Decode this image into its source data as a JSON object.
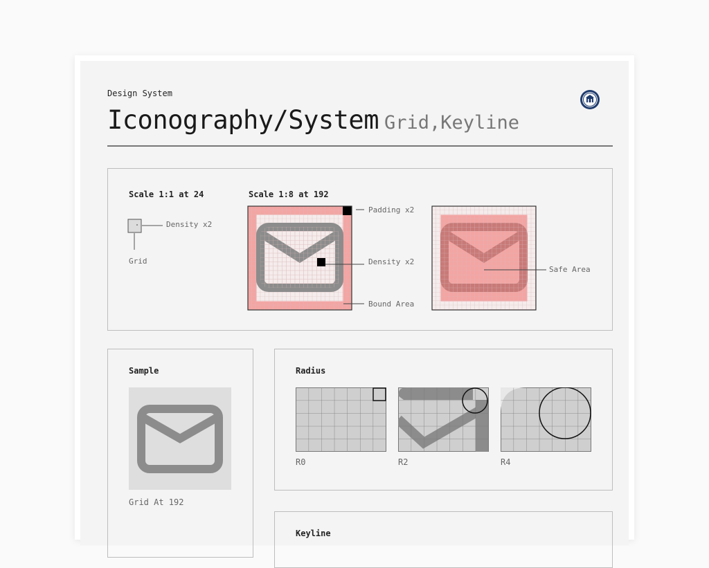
{
  "header": {
    "eyebrow": "Design System",
    "title": "Iconography/System",
    "subtitle": "Grid,Keyline"
  },
  "logo": {
    "icon": "seal-logo"
  },
  "scale_panel": {
    "small": {
      "label": "Scale 1:1 at 24",
      "annotations": {
        "density": "Density x2",
        "grid": "Grid"
      }
    },
    "large": {
      "label": "Scale 1:8 at 192",
      "annotations": {
        "padding": "Padding x2",
        "density": "Density x2",
        "bound": "Bound Area",
        "safe": "Safe Area"
      }
    }
  },
  "sample_panel": {
    "label": "Sample",
    "caption": "Grid At 192",
    "icon": "mail-icon"
  },
  "radius_panel": {
    "label": "Radius",
    "items": [
      {
        "caption": "R0"
      },
      {
        "caption": "R2"
      },
      {
        "caption": "R4"
      }
    ]
  },
  "keyline_panel": {
    "label": "Keyline"
  },
  "colors": {
    "bound_area": "#f3a5a3",
    "safe_area": "#f3a5a3",
    "icon_stroke": "#8c8c8c",
    "grid_fill": "#cfcfcf",
    "background": "#f4f4f4"
  }
}
